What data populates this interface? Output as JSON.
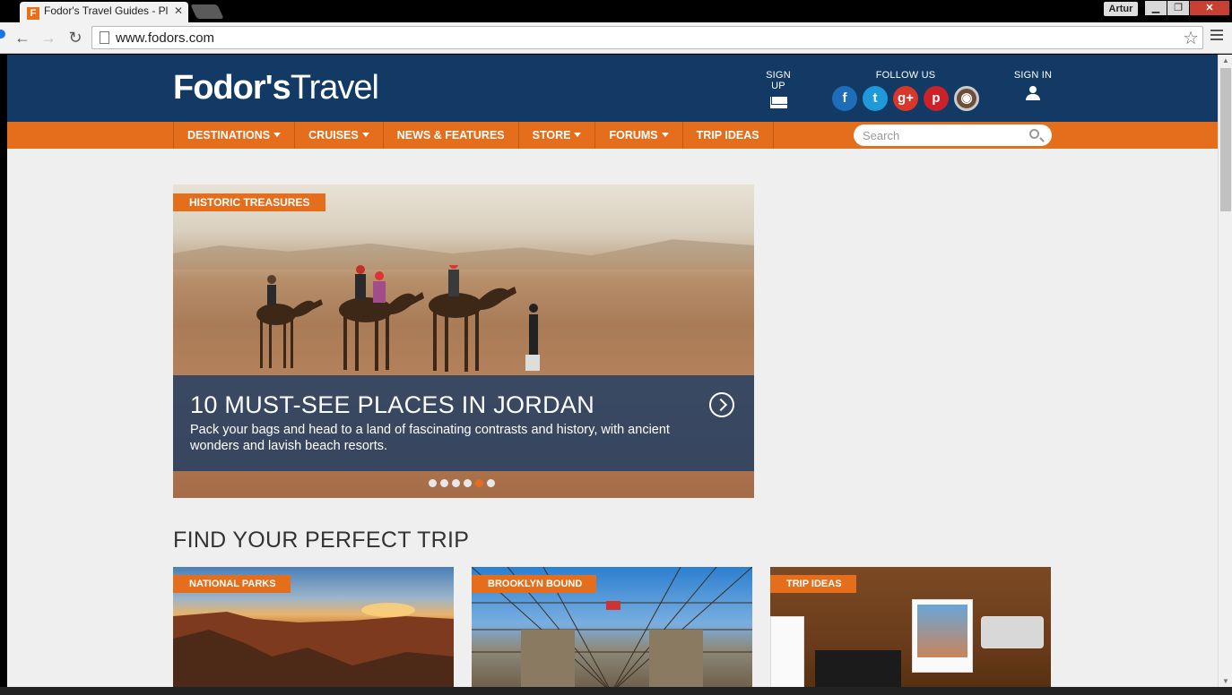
{
  "browser": {
    "tab_title": "Fodor's Travel Guides - Pl",
    "favicon_letter": "F",
    "user_name": "Artur",
    "url": "www.fodors.com"
  },
  "header": {
    "logo_bold": "Fodor's",
    "logo_light": "Travel",
    "signup_label": "SIGN UP",
    "follow_label": "FOLLOW US",
    "signin_label": "SIGN IN",
    "social_icons": [
      "facebook-icon",
      "twitter-icon",
      "google-plus-icon",
      "pinterest-icon",
      "instagram-icon"
    ]
  },
  "nav": {
    "items": [
      {
        "label": "DESTINATIONS",
        "dropdown": true
      },
      {
        "label": "CRUISES",
        "dropdown": true
      },
      {
        "label": "NEWS & FEATURES",
        "dropdown": false
      },
      {
        "label": "STORE",
        "dropdown": true
      },
      {
        "label": "FORUMS",
        "dropdown": true
      },
      {
        "label": "TRIP IDEAS",
        "dropdown": false
      }
    ],
    "search_placeholder": "Search"
  },
  "hero": {
    "tag": "HISTORIC TREASURES",
    "title": "10 MUST-SEE PLACES IN JORDAN",
    "description": "Pack your bags and head to a land of fascinating contrasts and history, with ancient wonders and lavish beach resorts.",
    "slide_count": 6,
    "active_slide": 5
  },
  "section": {
    "title": "FIND YOUR PERFECT TRIP"
  },
  "cards": [
    {
      "tag": "NATIONAL PARKS"
    },
    {
      "tag": "BROOKLYN BOUND"
    },
    {
      "tag": "TRIP IDEAS"
    }
  ],
  "colors": {
    "header_blue": "#123a64",
    "accent_orange": "#e56e1c"
  }
}
